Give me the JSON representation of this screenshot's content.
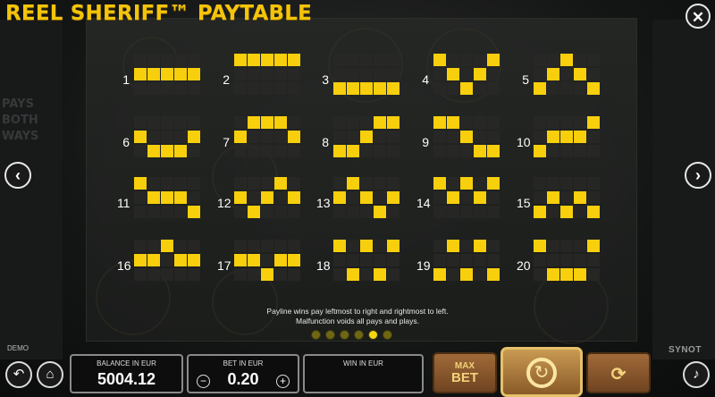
{
  "header": {
    "title": "REEL SHERIFF™ PAYTABLE"
  },
  "paylines": [
    {
      "number": "1",
      "rows": [
        1,
        1,
        1,
        1,
        1
      ]
    },
    {
      "number": "2",
      "rows": [
        0,
        0,
        0,
        0,
        0
      ]
    },
    {
      "number": "3",
      "rows": [
        2,
        2,
        2,
        2,
        2
      ]
    },
    {
      "number": "4",
      "rows": [
        0,
        1,
        2,
        1,
        0
      ]
    },
    {
      "number": "5",
      "rows": [
        2,
        1,
        0,
        1,
        2
      ]
    },
    {
      "number": "6",
      "rows": [
        1,
        2,
        2,
        2,
        1
      ]
    },
    {
      "number": "7",
      "rows": [
        1,
        0,
        0,
        0,
        1
      ]
    },
    {
      "number": "8",
      "rows": [
        2,
        2,
        1,
        0,
        0
      ]
    },
    {
      "number": "9",
      "rows": [
        0,
        0,
        1,
        2,
        2
      ]
    },
    {
      "number": "10",
      "rows": [
        2,
        1,
        1,
        1,
        0
      ]
    },
    {
      "number": "11",
      "rows": [
        0,
        1,
        1,
        1,
        2
      ]
    },
    {
      "number": "12",
      "rows": [
        1,
        2,
        1,
        0,
        1
      ]
    },
    {
      "number": "13",
      "rows": [
        1,
        0,
        1,
        2,
        1
      ]
    },
    {
      "number": "14",
      "rows": [
        0,
        1,
        0,
        1,
        0
      ]
    },
    {
      "number": "15",
      "rows": [
        2,
        1,
        2,
        1,
        2
      ]
    },
    {
      "number": "16",
      "rows": [
        1,
        1,
        0,
        1,
        1
      ]
    },
    {
      "number": "17",
      "rows": [
        1,
        1,
        2,
        1,
        1
      ]
    },
    {
      "number": "18",
      "rows": [
        0,
        2,
        0,
        2,
        0
      ]
    },
    {
      "number": "19",
      "rows": [
        2,
        0,
        2,
        0,
        2
      ]
    },
    {
      "number": "20",
      "rows": [
        0,
        2,
        2,
        2,
        0
      ]
    }
  ],
  "rules": {
    "line1": "Payline wins pay leftmost to right and rightmost to left.",
    "line2": "Malfunction voids all pays and plays."
  },
  "pagination": {
    "total": 6,
    "active_index": 4
  },
  "background": {
    "side_text": [
      "PAYS",
      "BOTH",
      "WAYS"
    ]
  },
  "footer": {
    "mode_label": "DEMO",
    "brand": "SYNOT",
    "balance_label": "BALANCE IN EUR",
    "balance_value": "5004.12",
    "bet_label": "BET IN EUR",
    "bet_value": "0.20",
    "win_label": "WIN IN EUR",
    "win_value": "",
    "max_bet_label_1": "MAX",
    "max_bet_label_2": "BET",
    "minus": "−",
    "plus": "+"
  },
  "icons": {
    "close": "close-icon",
    "prev": "chevron-left-icon",
    "next": "chevron-right-icon",
    "back": "back-icon",
    "home": "home-icon",
    "sound": "speaker-icon",
    "spin": "spin-icon",
    "autoplay": "autoplay-icon"
  },
  "colors": {
    "accent": "#f8cf0c",
    "title": "#f4c40a",
    "cell_off": "#282826"
  }
}
